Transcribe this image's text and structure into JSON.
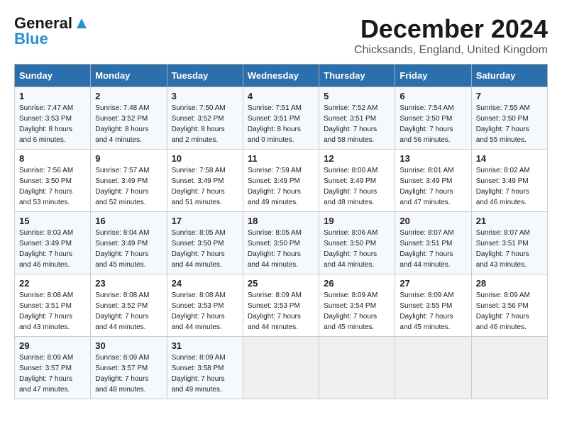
{
  "logo": {
    "line1": "General",
    "line2": "Blue"
  },
  "title": "December 2024",
  "location": "Chicksands, England, United Kingdom",
  "days_of_week": [
    "Sunday",
    "Monday",
    "Tuesday",
    "Wednesday",
    "Thursday",
    "Friday",
    "Saturday"
  ],
  "weeks": [
    [
      {
        "day": "1",
        "sunrise": "Sunrise: 7:47 AM",
        "sunset": "Sunset: 3:53 PM",
        "daylight": "Daylight: 8 hours and 6 minutes."
      },
      {
        "day": "2",
        "sunrise": "Sunrise: 7:48 AM",
        "sunset": "Sunset: 3:52 PM",
        "daylight": "Daylight: 8 hours and 4 minutes."
      },
      {
        "day": "3",
        "sunrise": "Sunrise: 7:50 AM",
        "sunset": "Sunset: 3:52 PM",
        "daylight": "Daylight: 8 hours and 2 minutes."
      },
      {
        "day": "4",
        "sunrise": "Sunrise: 7:51 AM",
        "sunset": "Sunset: 3:51 PM",
        "daylight": "Daylight: 8 hours and 0 minutes."
      },
      {
        "day": "5",
        "sunrise": "Sunrise: 7:52 AM",
        "sunset": "Sunset: 3:51 PM",
        "daylight": "Daylight: 7 hours and 58 minutes."
      },
      {
        "day": "6",
        "sunrise": "Sunrise: 7:54 AM",
        "sunset": "Sunset: 3:50 PM",
        "daylight": "Daylight: 7 hours and 56 minutes."
      },
      {
        "day": "7",
        "sunrise": "Sunrise: 7:55 AM",
        "sunset": "Sunset: 3:50 PM",
        "daylight": "Daylight: 7 hours and 55 minutes."
      }
    ],
    [
      {
        "day": "8",
        "sunrise": "Sunrise: 7:56 AM",
        "sunset": "Sunset: 3:50 PM",
        "daylight": "Daylight: 7 hours and 53 minutes."
      },
      {
        "day": "9",
        "sunrise": "Sunrise: 7:57 AM",
        "sunset": "Sunset: 3:49 PM",
        "daylight": "Daylight: 7 hours and 52 minutes."
      },
      {
        "day": "10",
        "sunrise": "Sunrise: 7:58 AM",
        "sunset": "Sunset: 3:49 PM",
        "daylight": "Daylight: 7 hours and 51 minutes."
      },
      {
        "day": "11",
        "sunrise": "Sunrise: 7:59 AM",
        "sunset": "Sunset: 3:49 PM",
        "daylight": "Daylight: 7 hours and 49 minutes."
      },
      {
        "day": "12",
        "sunrise": "Sunrise: 8:00 AM",
        "sunset": "Sunset: 3:49 PM",
        "daylight": "Daylight: 7 hours and 48 minutes."
      },
      {
        "day": "13",
        "sunrise": "Sunrise: 8:01 AM",
        "sunset": "Sunset: 3:49 PM",
        "daylight": "Daylight: 7 hours and 47 minutes."
      },
      {
        "day": "14",
        "sunrise": "Sunrise: 8:02 AM",
        "sunset": "Sunset: 3:49 PM",
        "daylight": "Daylight: 7 hours and 46 minutes."
      }
    ],
    [
      {
        "day": "15",
        "sunrise": "Sunrise: 8:03 AM",
        "sunset": "Sunset: 3:49 PM",
        "daylight": "Daylight: 7 hours and 46 minutes."
      },
      {
        "day": "16",
        "sunrise": "Sunrise: 8:04 AM",
        "sunset": "Sunset: 3:49 PM",
        "daylight": "Daylight: 7 hours and 45 minutes."
      },
      {
        "day": "17",
        "sunrise": "Sunrise: 8:05 AM",
        "sunset": "Sunset: 3:50 PM",
        "daylight": "Daylight: 7 hours and 44 minutes."
      },
      {
        "day": "18",
        "sunrise": "Sunrise: 8:05 AM",
        "sunset": "Sunset: 3:50 PM",
        "daylight": "Daylight: 7 hours and 44 minutes."
      },
      {
        "day": "19",
        "sunrise": "Sunrise: 8:06 AM",
        "sunset": "Sunset: 3:50 PM",
        "daylight": "Daylight: 7 hours and 44 minutes."
      },
      {
        "day": "20",
        "sunrise": "Sunrise: 8:07 AM",
        "sunset": "Sunset: 3:51 PM",
        "daylight": "Daylight: 7 hours and 44 minutes."
      },
      {
        "day": "21",
        "sunrise": "Sunrise: 8:07 AM",
        "sunset": "Sunset: 3:51 PM",
        "daylight": "Daylight: 7 hours and 43 minutes."
      }
    ],
    [
      {
        "day": "22",
        "sunrise": "Sunrise: 8:08 AM",
        "sunset": "Sunset: 3:51 PM",
        "daylight": "Daylight: 7 hours and 43 minutes."
      },
      {
        "day": "23",
        "sunrise": "Sunrise: 8:08 AM",
        "sunset": "Sunset: 3:52 PM",
        "daylight": "Daylight: 7 hours and 44 minutes."
      },
      {
        "day": "24",
        "sunrise": "Sunrise: 8:08 AM",
        "sunset": "Sunset: 3:53 PM",
        "daylight": "Daylight: 7 hours and 44 minutes."
      },
      {
        "day": "25",
        "sunrise": "Sunrise: 8:09 AM",
        "sunset": "Sunset: 3:53 PM",
        "daylight": "Daylight: 7 hours and 44 minutes."
      },
      {
        "day": "26",
        "sunrise": "Sunrise: 8:09 AM",
        "sunset": "Sunset: 3:54 PM",
        "daylight": "Daylight: 7 hours and 45 minutes."
      },
      {
        "day": "27",
        "sunrise": "Sunrise: 8:09 AM",
        "sunset": "Sunset: 3:55 PM",
        "daylight": "Daylight: 7 hours and 45 minutes."
      },
      {
        "day": "28",
        "sunrise": "Sunrise: 8:09 AM",
        "sunset": "Sunset: 3:56 PM",
        "daylight": "Daylight: 7 hours and 46 minutes."
      }
    ],
    [
      {
        "day": "29",
        "sunrise": "Sunrise: 8:09 AM",
        "sunset": "Sunset: 3:57 PM",
        "daylight": "Daylight: 7 hours and 47 minutes."
      },
      {
        "day": "30",
        "sunrise": "Sunrise: 8:09 AM",
        "sunset": "Sunset: 3:57 PM",
        "daylight": "Daylight: 7 hours and 48 minutes."
      },
      {
        "day": "31",
        "sunrise": "Sunrise: 8:09 AM",
        "sunset": "Sunset: 3:58 PM",
        "daylight": "Daylight: 7 hours and 49 minutes."
      },
      null,
      null,
      null,
      null
    ]
  ]
}
